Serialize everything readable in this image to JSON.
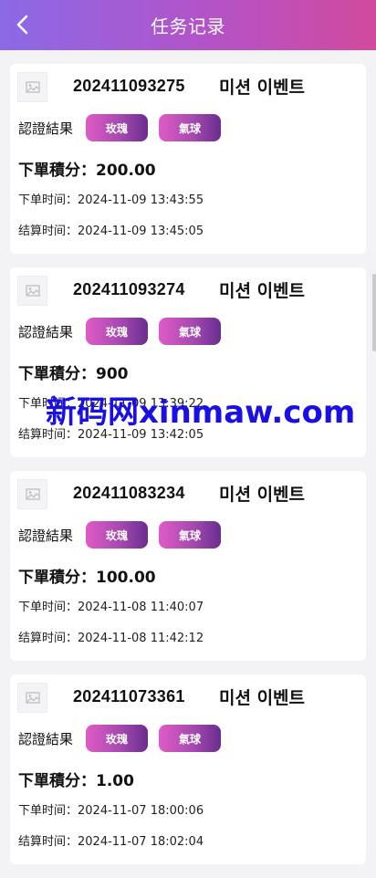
{
  "header": {
    "title": "任务记录",
    "back_icon": "chevron-left-icon"
  },
  "result_label": "認證結果",
  "score_prefix": "下單積分：",
  "order_time_prefix": "下单时间：",
  "settle_time_prefix": "结算时间：",
  "records": [
    {
      "order_no": "202411093275",
      "event": "미션 이벤트",
      "tags": [
        "玫瑰",
        "氣球"
      ],
      "score": "200.00",
      "order_time": "2024-11-09 13:43:55",
      "settle_time": "2024-11-09 13:45:05"
    },
    {
      "order_no": "202411093274",
      "event": "미션 이벤트",
      "tags": [
        "玫瑰",
        "氣球"
      ],
      "score": "900",
      "order_time": "2024-11-09 13:39:22",
      "settle_time": "2024-11-09 13:42:05"
    },
    {
      "order_no": "202411083234",
      "event": "미션 이벤트",
      "tags": [
        "玫瑰",
        "氣球"
      ],
      "score": "100.00",
      "order_time": "2024-11-08 11:40:07",
      "settle_time": "2024-11-08 11:42:12"
    },
    {
      "order_no": "202411073361",
      "event": "미션 이벤트",
      "tags": [
        "玫瑰",
        "氣球"
      ],
      "score": "1.00",
      "order_time": "2024-11-07 18:00:06",
      "settle_time": "2024-11-07 18:02:04"
    }
  ],
  "watermark": "新码网xinmaw.com",
  "colors": {
    "header_start": "#8b6ae6",
    "header_end": "#d14a9d",
    "tag_start": "#e05bc6",
    "tag_end": "#6b2d8f",
    "watermark": "#1a10e6"
  }
}
